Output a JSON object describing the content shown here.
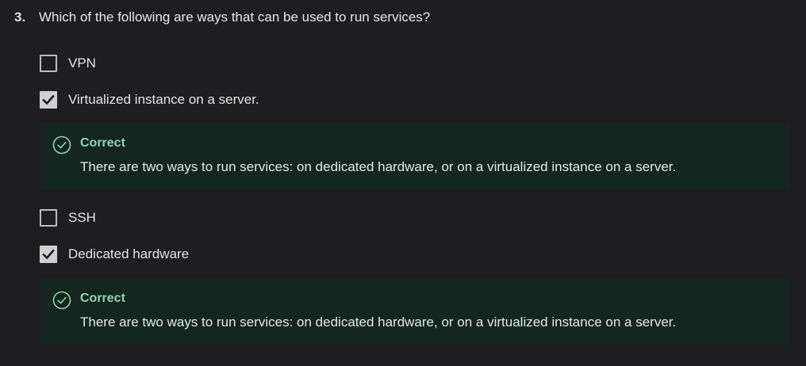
{
  "question": {
    "number": "3.",
    "text": "Which of the following are ways that can be used to run services?"
  },
  "options": [
    {
      "label": "VPN",
      "checked": false
    },
    {
      "label": "Virtualized instance on a server.",
      "checked": true
    },
    {
      "label": "SSH",
      "checked": false
    },
    {
      "label": "Dedicated hardware",
      "checked": true
    }
  ],
  "feedback": [
    {
      "status": "Correct",
      "text": "There are two ways to run services: on dedicated hardware, or on a virtualized instance on a server."
    },
    {
      "status": "Correct",
      "text": "There are two ways to run services: on dedicated hardware, or on a virtualized instance on a server."
    }
  ],
  "colors": {
    "background": "#1e1e20",
    "feedback_background": "#14261f",
    "correct_green": "#8fd4b0",
    "checkbox_checked": "#d0d0d0"
  },
  "icons": {
    "check": "check-icon",
    "correct": "check-circle-icon"
  }
}
